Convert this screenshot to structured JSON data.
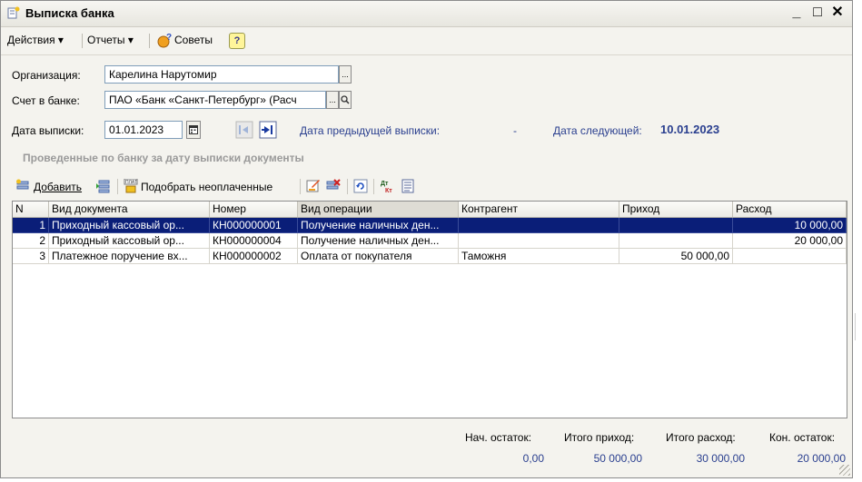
{
  "window": {
    "title": "Выписка банка",
    "minimize": "_",
    "maximize": "□",
    "close": "✕"
  },
  "menu": {
    "actions": "Действия ▾",
    "reports": "Отчеты ▾",
    "tips": "Советы",
    "help": "?"
  },
  "form": {
    "org_label": "Организация:",
    "org_value": "Карелина Нарутомир",
    "account_label": "Счет в банке:",
    "account_value": "ПАО «Банк «Санкт-Петербург» (Расч",
    "date_label": "Дата выписки:",
    "date_value": "01.01.2023",
    "prev_date_label": "Дата предыдущей выписки:",
    "prev_date_value": "-",
    "next_date_label": "Дата следующей:",
    "next_date_value": "10.01.2023",
    "ellipsis": "...",
    "search": "🔍"
  },
  "section_title": "Проведенные по банку за дату выписки документы",
  "toolbar": {
    "add_label": "Добавить",
    "pick_unpaid_label": "Подобрать неоплаченные"
  },
  "table": {
    "columns": [
      "N",
      "Вид документа",
      "Номер",
      "Вид операции",
      "Контрагент",
      "Приход",
      "Расход"
    ],
    "rows": [
      {
        "n": "1",
        "doc": "Приходный кассовый ор...",
        "num": "КН000000001",
        "op": "Получение наличных ден...",
        "party": "",
        "income": "",
        "expense": "10 000,00",
        "selected": true
      },
      {
        "n": "2",
        "doc": "Приходный кассовый ор...",
        "num": "КН000000004",
        "op": "Получение наличных ден...",
        "party": "",
        "income": "",
        "expense": "20 000,00",
        "selected": false
      },
      {
        "n": "3",
        "doc": "Платежное поручение вх...",
        "num": "КН000000002",
        "op": "Оплата от покупателя",
        "party": "Таможня",
        "income": "50 000,00",
        "expense": "",
        "selected": false
      }
    ]
  },
  "totals": {
    "start_label": "Нач. остаток:",
    "start_value": "0,00",
    "income_label": "Итого приход:",
    "income_value": "50 000,00",
    "expense_label": "Итого расход:",
    "expense_value": "30 000,00",
    "end_label": "Кон. остаток:",
    "end_value": "20 000,00"
  },
  "colors": {
    "selection": "#0a1e78",
    "accent_text": "#2a3f8f"
  }
}
